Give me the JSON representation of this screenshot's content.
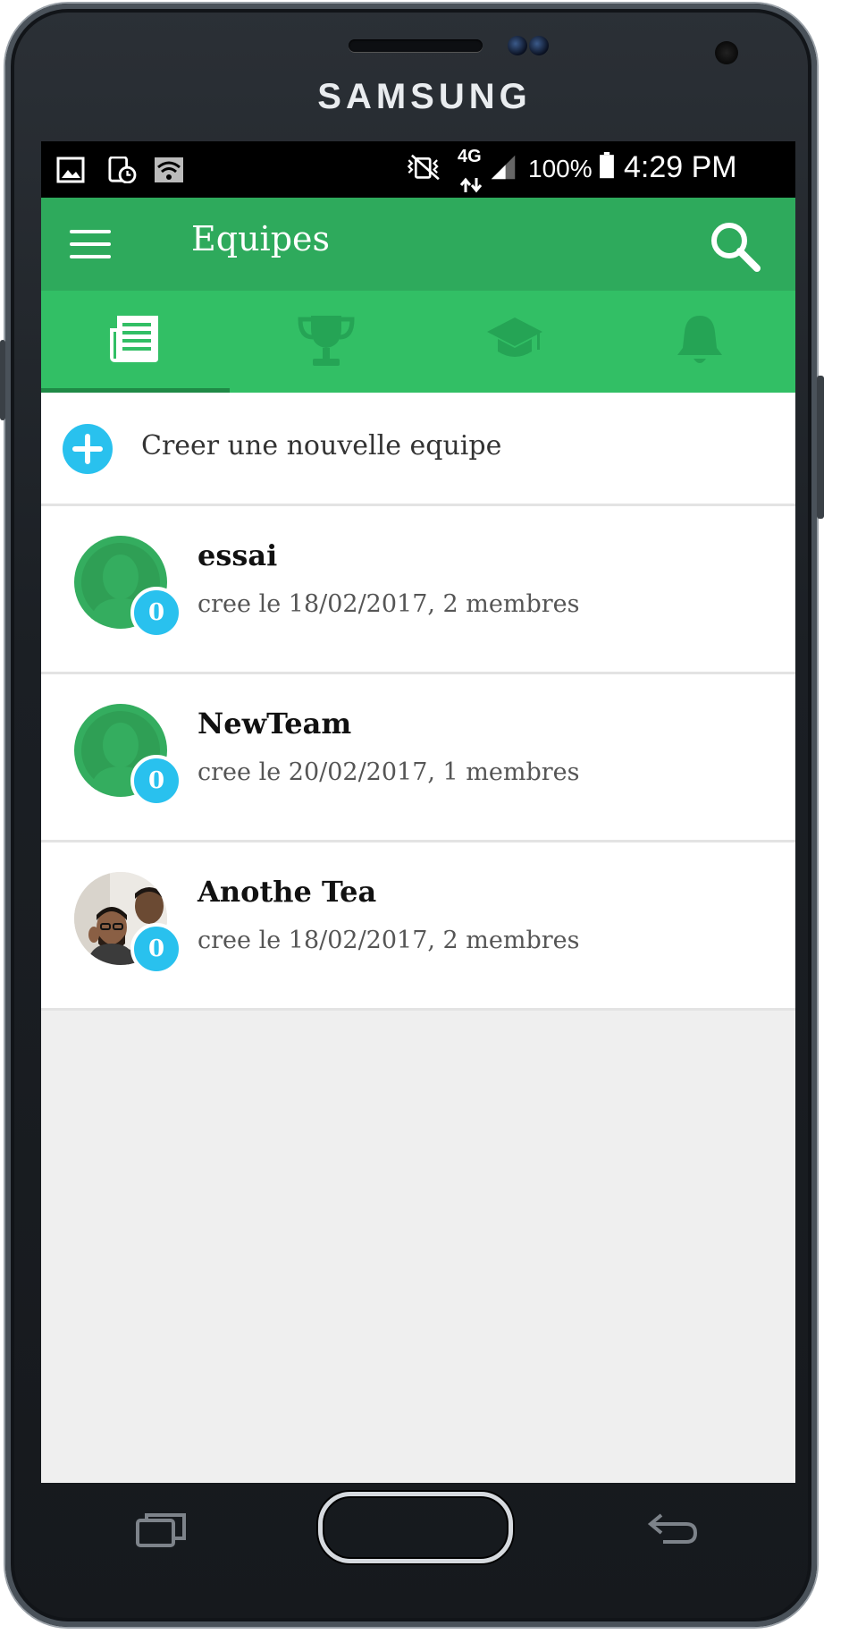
{
  "device": {
    "brand": "SAMSUNG"
  },
  "status_bar": {
    "network": "4G",
    "battery": "100%",
    "time": "4:29 PM",
    "left_icons": [
      "image-icon",
      "screen-timer-icon",
      "wifi-icon"
    ],
    "right_icons": [
      "mute-vibrate-icon",
      "network-4g-icon",
      "signal-icon",
      "battery-icon"
    ]
  },
  "app_bar": {
    "title": "Equipes",
    "menu_icon": "hamburger-menu-icon",
    "search_icon": "search-icon"
  },
  "tabs": [
    {
      "icon": "newspaper-icon",
      "active": true
    },
    {
      "icon": "trophy-icon",
      "active": false
    },
    {
      "icon": "graduation-cap-icon",
      "active": false
    },
    {
      "icon": "bell-icon",
      "active": false
    }
  ],
  "create_team": {
    "label": "Creer une nouvelle equipe",
    "icon": "plus-icon"
  },
  "teams": [
    {
      "name": "essai",
      "meta": "cree le 18/02/2017, 2 membres",
      "badge": "0",
      "avatar": "default-avatar"
    },
    {
      "name": "NewTeam",
      "meta": "cree le 20/02/2017, 1 membres",
      "badge": "0",
      "avatar": "default-avatar"
    },
    {
      "name": "Anothe Tea",
      "meta": "cree le 18/02/2017, 2 membres",
      "badge": "0",
      "avatar": "photo-avatar"
    }
  ],
  "colors": {
    "appbar": "#2eaa5c",
    "tabbar": "#32bf65",
    "accent_blue": "#29c1ee",
    "background": "#efefef"
  },
  "nav_buttons": [
    "recent-apps-icon",
    "home-button",
    "back-icon"
  ]
}
